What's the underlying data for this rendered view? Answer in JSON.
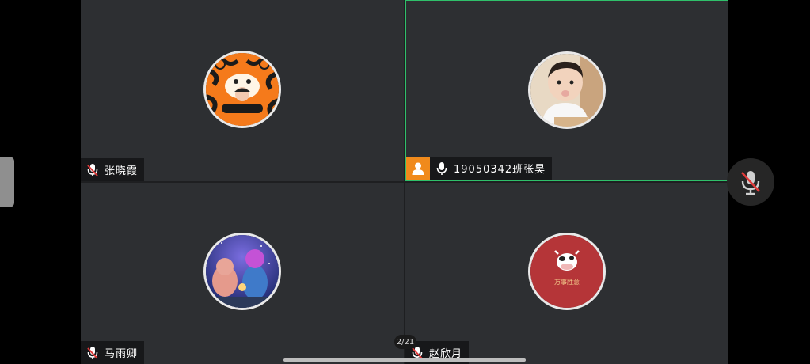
{
  "meeting": {
    "page_indicator": "2/21",
    "participants": [
      {
        "name": "张晓霞",
        "muted": true,
        "host": false,
        "active_speaker": false,
        "avatar": "tiger-avatar"
      },
      {
        "name": "19050342班张昊",
        "muted": false,
        "host": true,
        "active_speaker": true,
        "avatar": "child-photo-avatar"
      },
      {
        "name": "马雨卿",
        "muted": true,
        "host": false,
        "active_speaker": false,
        "avatar": "anime-night-avatar"
      },
      {
        "name": "赵欣月",
        "muted": true,
        "host": false,
        "active_speaker": false,
        "avatar": "cow-avatar",
        "avatar_text": "万事胜意"
      }
    ]
  },
  "controls": {
    "self_mic": "muted"
  },
  "colors": {
    "active_border": "#2fc06a",
    "host_badge": "#f08a1c",
    "muted_mic": "#e23a3a"
  }
}
